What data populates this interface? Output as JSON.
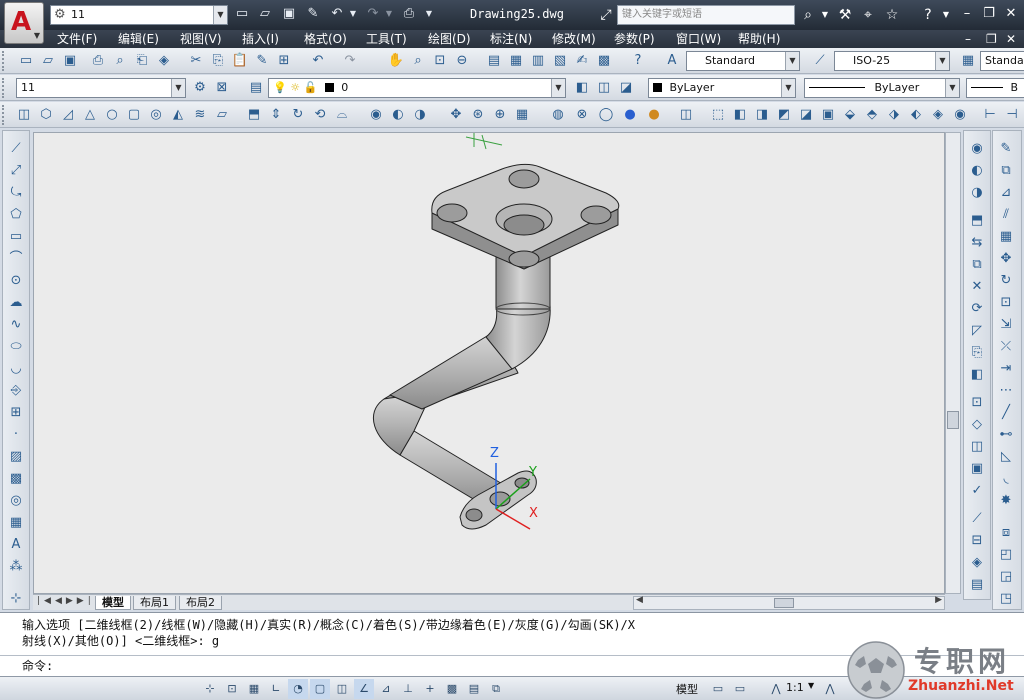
{
  "title_bar": {
    "app_logo": "A",
    "workspace": "11",
    "document_title": "Drawing25.dwg",
    "search_placeholder": "键入关键字或短语"
  },
  "menu": {
    "items": [
      "文件(F)",
      "编辑(E)",
      "视图(V)",
      "插入(I)",
      "格式(O)",
      "工具(T)",
      "绘图(D)",
      "标注(N)",
      "修改(M)",
      "参数(P)",
      "窗口(W)",
      "帮助(H)"
    ]
  },
  "toolbars": {
    "text_style": "Standard",
    "dim_style": "ISO-25",
    "table_style": "Standard",
    "workspace_combo": "11",
    "layer_name": "0",
    "color": "ByLayer",
    "linetype": "ByLayer",
    "lineweight": "B"
  },
  "tabs": [
    "模型",
    "布局1",
    "布局2"
  ],
  "active_tab": "模型",
  "command": {
    "line1": "输入选项 [二维线框(2)/线框(W)/隐藏(H)/真实(R)/概念(C)/着色(S)/带边缘着色(E)/灰度(G)/勾画(SK)/X",
    "line2": "射线(X)/其他(O)] <二维线框>: g",
    "prompt": "命令:"
  },
  "status": {
    "model_label": "模型",
    "scale": "1:1"
  },
  "axes": {
    "x": "X",
    "y": "Y",
    "z": "Z"
  },
  "watermark": {
    "title": "专职网",
    "url": "Zhuanzhi.Net"
  },
  "colors": {
    "titlebar": "#2b3440",
    "canvas": "#ebebeb",
    "model": "#a9a9a9",
    "axis_x": "#e02020",
    "axis_y": "#1aa01a",
    "axis_z": "#2060e0"
  }
}
